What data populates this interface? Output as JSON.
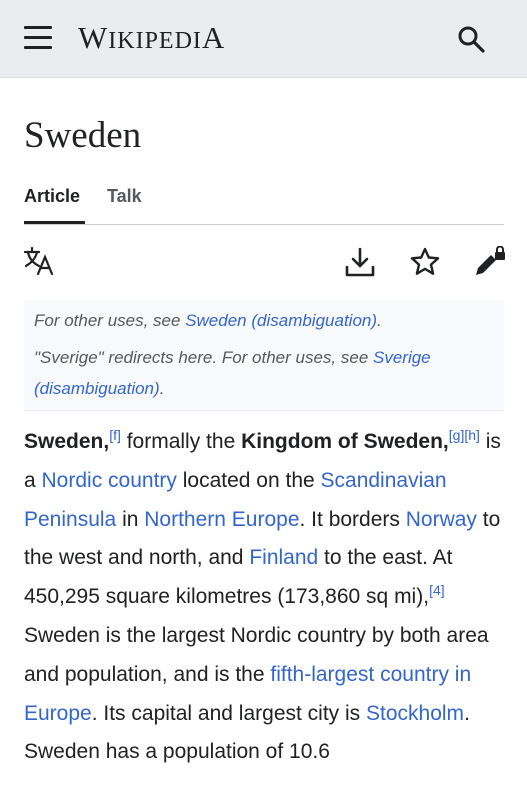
{
  "header": {
    "logo_first": "W",
    "logo_rest": "IKIPEDI",
    "logo_last": "A"
  },
  "page": {
    "title": "Sweden"
  },
  "tabs": [
    {
      "label": "Article"
    },
    {
      "label": "Talk"
    }
  ],
  "hatnote": {
    "line1_prefix": "For other uses, see ",
    "line1_link": "Sweden (disambiguation)",
    "line1_suffix": ".",
    "line2_prefix": "\"Sverige\" redirects here. For other uses, see ",
    "line2_link": "Sverige (disambiguation)",
    "line2_suffix": "."
  },
  "intro": {
    "s1": "Sweden,",
    "ref_f": "[f]",
    "s2": " formally the ",
    "s3": "Kingdom of Sweden,",
    "ref_g": "[g]",
    "ref_h": "[h]",
    "s4": " is a ",
    "link_nordic": "Nordic country",
    "s5": " located on the ",
    "link_scandinavian": "Scandinavian Peninsula",
    "s6": " in ",
    "link_northern_europe": "Northern Europe",
    "s7": ". It borders ",
    "link_norway": "Norway",
    "s8": " to the west and north, and ",
    "link_finland": "Finland",
    "s9": " to the east. At 450,295 square kilometres (173,860 sq mi),",
    "ref_4": "[4]",
    "s10": " Sweden is the largest Nordic country by both area and population, and is the ",
    "link_fifth": "fifth-largest country in Europe",
    "s11": ". Its capital and largest city is ",
    "link_stockholm": "Stockholm",
    "s12": ". Sweden has a population of 10.6"
  },
  "icons": {
    "menu": "hamburger-menu-icon",
    "search": "search-icon",
    "language": "language-icon",
    "download": "download-icon",
    "watch": "star-icon",
    "protection": "lock-pencil-icon"
  }
}
